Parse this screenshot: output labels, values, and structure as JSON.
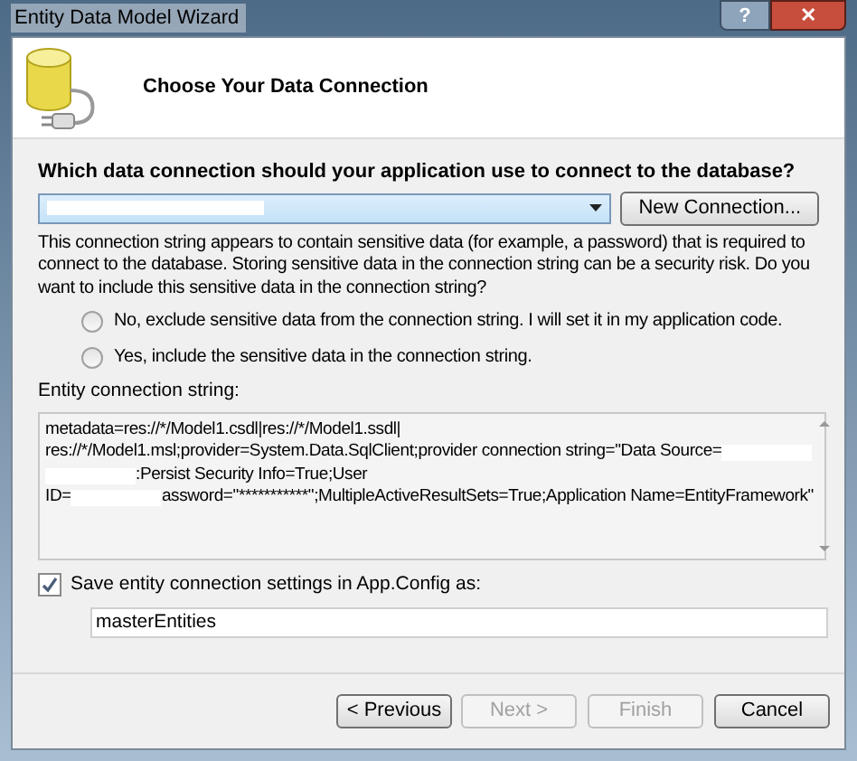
{
  "window": {
    "title": "Entity Data Model Wizard",
    "title_buttons": [
      "?",
      "✕"
    ]
  },
  "header": {
    "title": "Choose Your Data Connection"
  },
  "question": {
    "label": "Which data connection should your application use to connect to the database?"
  },
  "connection_dropdown": {
    "highlighted": true,
    "redacted": true
  },
  "new_connection_button": {
    "label": "New Connection..."
  },
  "warning": "This connection string appears to contain sensitive data (for example, a password) that is required to connect to the database. Storing sensitive data in the connection string can be a security risk. Do you want to include this sensitive data in the connection string?",
  "radios": [
    {
      "label": "No, exclude sensitive data from the connection string. I will set it in my application code.",
      "selected": false
    },
    {
      "label": "Yes, include the sensitive data in the connection string.",
      "selected": false
    }
  ],
  "connection_string": {
    "label": "Entity connection string:",
    "lines": [
      [
        {
          "kind": "text",
          "text": "metadata=res://*/Model1.csdl|res://*/Model1.ssdl|"
        }
      ],
      [
        {
          "kind": "text",
          "text": "res://*/Model1.msl;provider=System.Data.SqlClient;provider connection string=\"Data Source="
        },
        {
          "kind": "redacted"
        }
      ],
      [
        {
          "kind": "redacted"
        },
        {
          "kind": "text",
          "text": ":Persist Security Info=True;User"
        }
      ],
      [
        {
          "kind": "text",
          "text": "ID="
        },
        {
          "kind": "redacted"
        },
        {
          "kind": "text",
          "text": "assword=\"***********\";MultipleActiveResultSets=True;Application Name=EntityFramework\""
        }
      ]
    ]
  },
  "save_settings": {
    "label": "Save entity connection settings in App.Config as:",
    "checked": true,
    "value": "masterEntities"
  },
  "buttons": [
    {
      "label": "< Previous",
      "disabled": false
    },
    {
      "label": "Next >",
      "disabled": true
    },
    {
      "label": "Finish",
      "disabled": true
    },
    {
      "label": "Cancel",
      "disabled": false
    }
  ]
}
